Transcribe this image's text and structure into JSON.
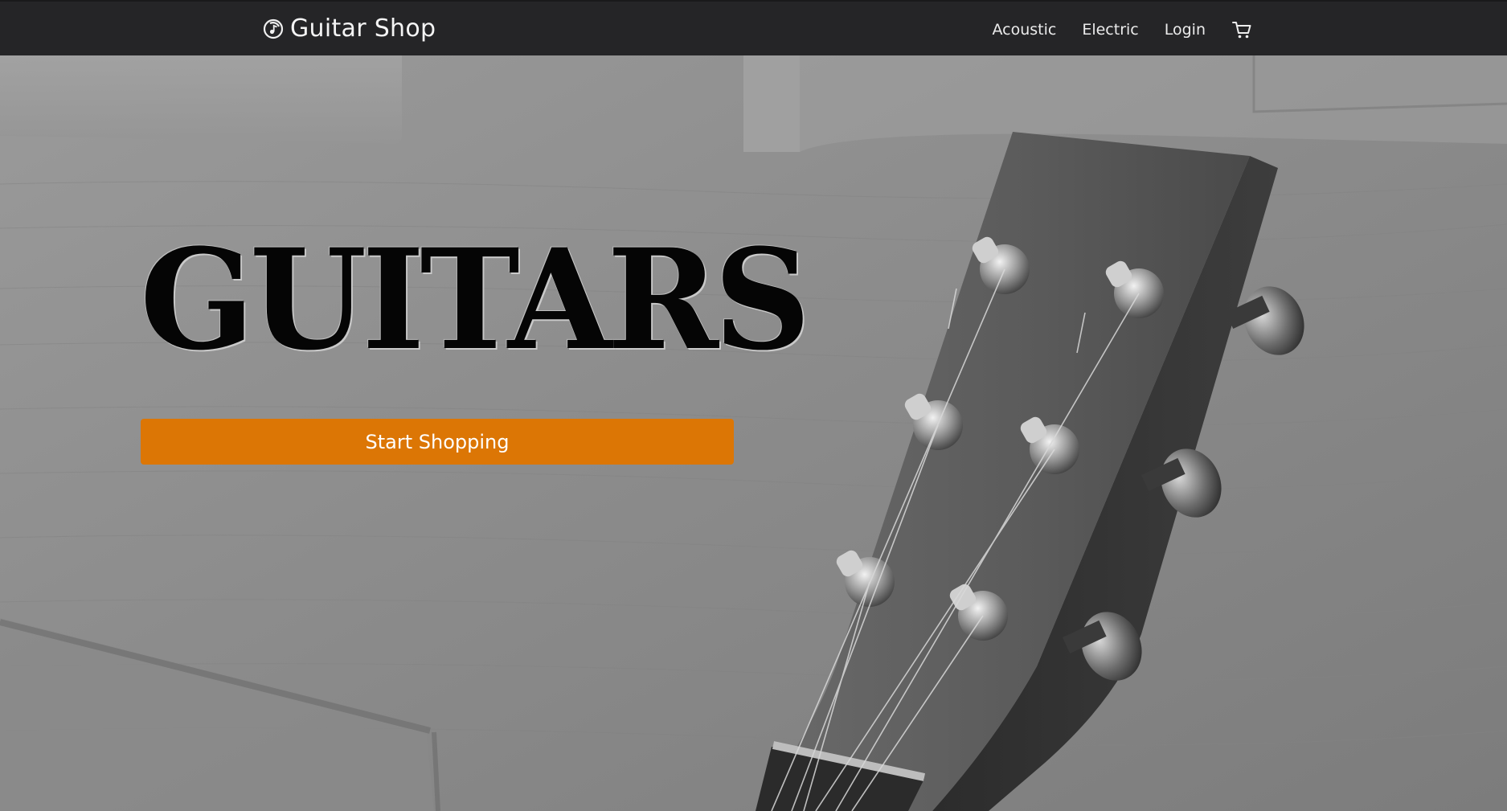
{
  "navbar": {
    "brand_name": "Guitar Shop",
    "brand_icon": "music-note-circle-icon",
    "links": [
      {
        "label": "Acoustic"
      },
      {
        "label": "Electric"
      },
      {
        "label": "Login"
      }
    ],
    "cart_icon": "shopping-cart-icon"
  },
  "hero": {
    "title": "GUITARS",
    "cta_label": "Start Shopping",
    "background_image": "grayscale photo of an acoustic guitar headstock leaning against a white paneled door"
  },
  "colors": {
    "navbar_bg": "#252527",
    "accent": "#dc7605",
    "text_light": "#f4f4f4",
    "title": "#050505"
  }
}
